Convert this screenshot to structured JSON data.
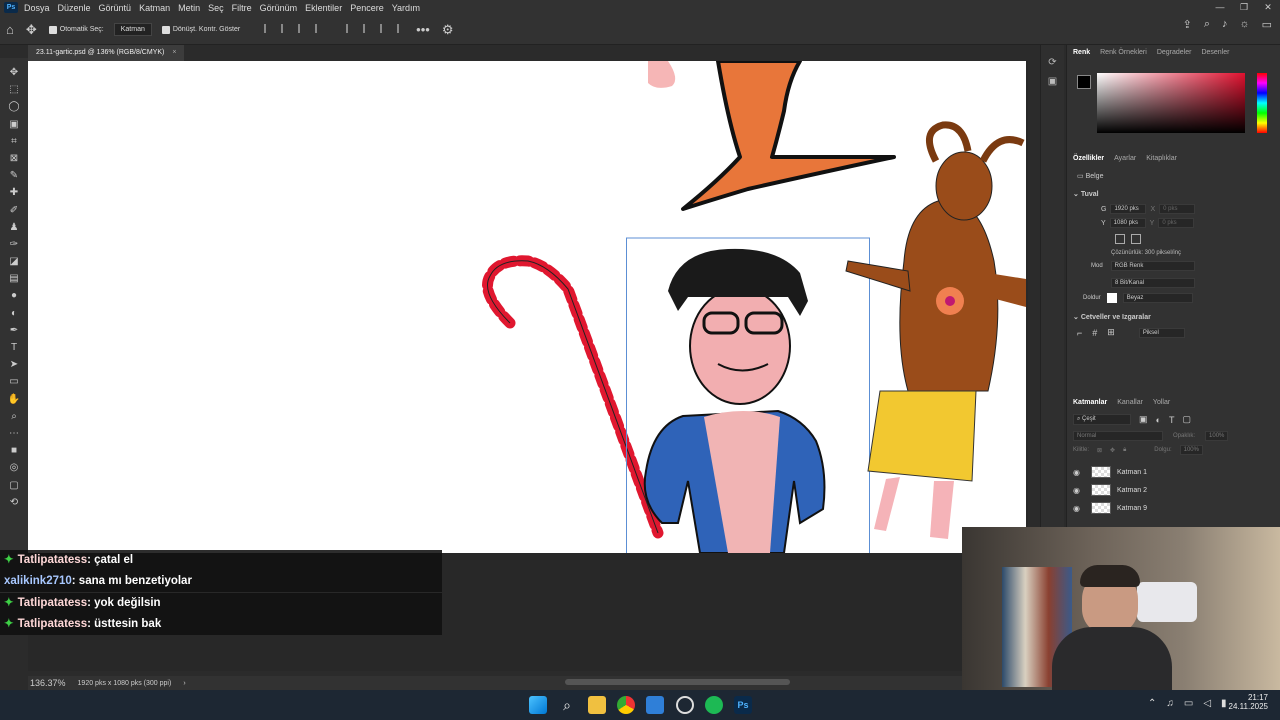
{
  "app": {
    "logo": "Ps"
  },
  "menu": [
    "Dosya",
    "Düzenle",
    "Görüntü",
    "Katman",
    "Metin",
    "Seç",
    "Filtre",
    "Görünüm",
    "Eklentiler",
    "Pencere",
    "Yardım"
  ],
  "options": {
    "auto_select_label": "Otomatik Seç:",
    "auto_select_value": "Katman",
    "transform_label": "Dönüşt. Kontr. Göster"
  },
  "doc_tab": {
    "title": "23.11-gartic.psd @ 136% (RGB/8/CMYK)",
    "close": "×"
  },
  "color_panel": {
    "tabs": [
      "Renk",
      "Renk Örnekleri",
      "Degradeler",
      "Desenler"
    ],
    "active_tab": "Renk",
    "hue_top": "#e0112f"
  },
  "properties": {
    "tabs": [
      "Özellikler",
      "Ayarlar",
      "Kitaplıklar"
    ],
    "doc_label": "Belge",
    "canvas_section": "Tuval",
    "w_label": "G",
    "w_value": "1920 pks",
    "h_label": "Y",
    "h_value": "1080 pks",
    "x_label": "X",
    "x_value": "0 pks",
    "y_label": "Y",
    "y_value": "0 pks",
    "resolution": "Çözünürlük: 300 piksel/inç",
    "mode_label": "Mod",
    "mode_value": "RGB Renk",
    "bits_value": "8 Bit/Kanal",
    "fill_label": "Doldur",
    "fill_value": "Beyaz",
    "rulers_section": "Cetveller ve Izgaralar",
    "units_value": "Piksel"
  },
  "layers_panel": {
    "tabs": [
      "Katmanlar",
      "Kanallar",
      "Yollar"
    ],
    "filter_label": "Çeşit",
    "blend_mode": "Normal",
    "opacity_label": "Opaklık:",
    "opacity_value": "100%",
    "lock_label": "Kilitle:",
    "fill_label": "Dolgu:",
    "fill_value": "100%",
    "layers": [
      "Katman 1",
      "Katman 2",
      "Katman 9"
    ]
  },
  "chat": [
    {
      "user": "Tatlipatatess",
      "message": ": çatal el",
      "badge": true
    },
    {
      "user": "xalikink2710",
      "message": ": sana mı benzetiyolar",
      "badge": false
    },
    {
      "user": "Tatlipatatess",
      "message": ": yok değilsin",
      "badge": true
    },
    {
      "user": "Tatlipatatess",
      "message": ": üsttesin bak",
      "badge": true
    }
  ],
  "status": {
    "zoom": "136.37%",
    "size": "1920 pks x 1080 pks (300 ppi)"
  },
  "taskbar": {
    "time": "21:17",
    "date": "24.11.2025"
  }
}
